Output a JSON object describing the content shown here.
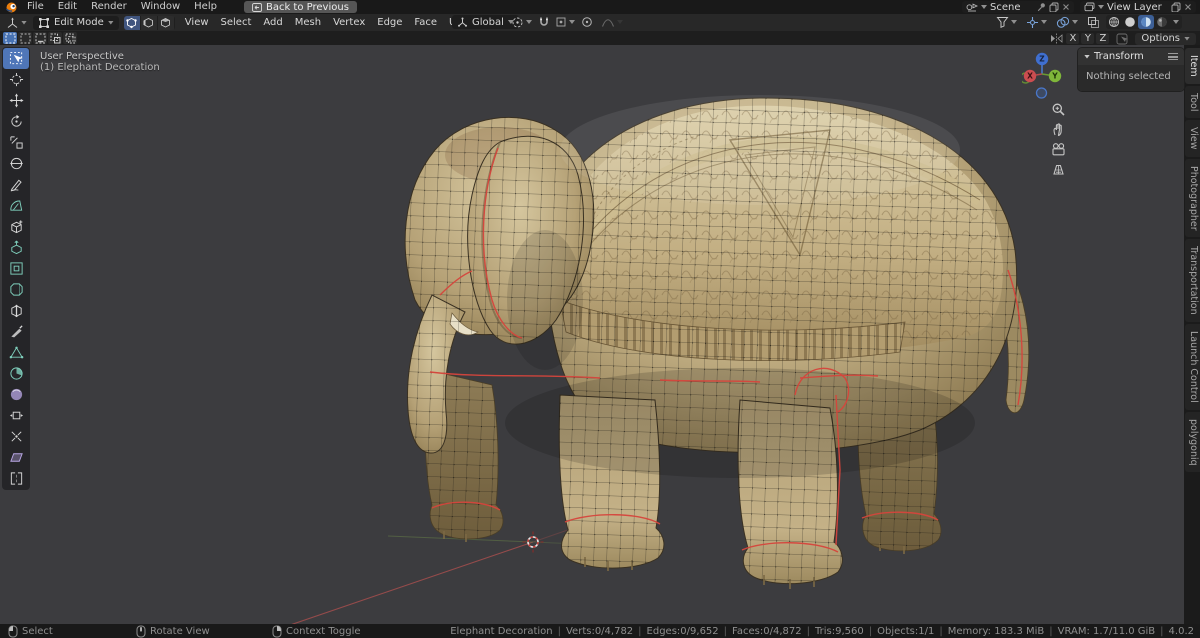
{
  "topbar": {
    "menus": [
      "File",
      "Edit",
      "Render",
      "Window",
      "Help"
    ],
    "back_button": "Back to Previous",
    "scene_selector": {
      "value": "Scene"
    },
    "view_layer_selector": {
      "value": "View Layer"
    }
  },
  "viewport_header": {
    "mode": "Edit Mode",
    "menus": [
      "View",
      "Select",
      "Add",
      "Mesh",
      "Vertex",
      "Edge",
      "Face",
      "UV"
    ],
    "orientation": "Global"
  },
  "tool_settings": {
    "mirror": [
      "X",
      "Y",
      "Z"
    ],
    "options_button": "Options"
  },
  "toolbar_tools": [
    "tweak",
    "cursor",
    "move",
    "rotate",
    "scale",
    "transform",
    "annotate",
    "measure",
    "add-cube",
    "extrude-region",
    "inset-faces",
    "bevel",
    "loop-cut",
    "knife",
    "poly-build",
    "spin",
    "smooth",
    "edge-slide",
    "shrink-fatten",
    "shear",
    "rip-region"
  ],
  "viewport": {
    "overlay": {
      "line1": "User Perspective",
      "line2": "(1) Elephant Decoration"
    },
    "gizmo": {
      "x_label": "X",
      "y_label": "Y",
      "z_label": "Z"
    }
  },
  "sidebar": {
    "tabs": [
      "Item",
      "Tool",
      "View",
      "Photographer",
      "Transportation",
      "Launch Control",
      "polygoniq"
    ],
    "active_tab": "Item",
    "transform_panel": {
      "title": "Transform",
      "body": "Nothing selected"
    }
  },
  "statusbar": {
    "hints": [
      {
        "label": "Select"
      },
      {
        "label": "Rotate View"
      },
      {
        "label": "Context Toggle"
      }
    ],
    "stats": [
      "Elephant Decoration",
      "Verts:0/4,782",
      "Edges:0/9,652",
      "Faces:0/4,872",
      "Tris:9,560",
      "Objects:1/1",
      "Memory: 183.3 MiB",
      "VRAM: 1.7/11.0 GiB",
      "4.0.2"
    ]
  },
  "colors": {
    "accent": "#4772b3",
    "axis_x": "#c5494a",
    "axis_y": "#7fb63a",
    "axis_z": "#3f6fd0",
    "seam_red": "#d6453c",
    "viewport_bg": "#3c3c3f"
  }
}
